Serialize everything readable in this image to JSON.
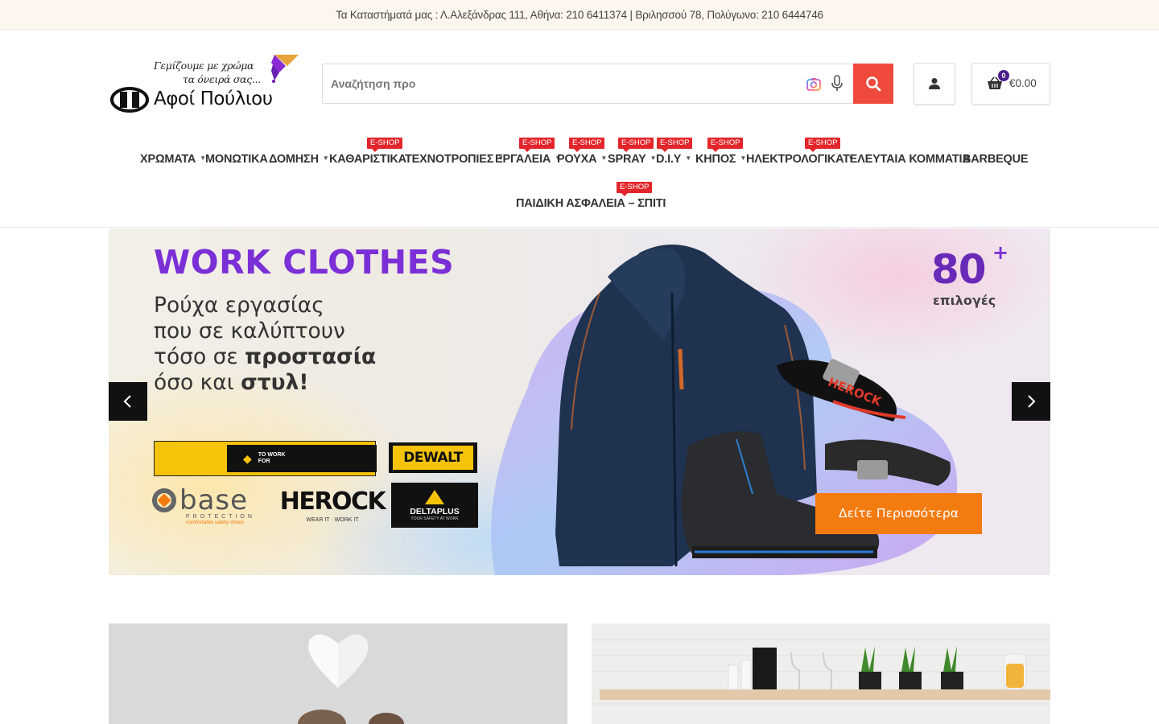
{
  "topbar": {
    "text": "Τα Καταστήματά μας : Λ.Αλεξάνδρας 111, Αθήνα: 210 6411374 | Βριλησσού 78, Πολύγωνο: 210 6444746"
  },
  "logo": {
    "tagline_line1": "Γεμίζουμε με χρώμα",
    "tagline_line2": "τα όνειρά σας...",
    "brand": "Αφοί Πούλιου"
  },
  "search": {
    "placeholder": "Αναζήτηση προ",
    "value": ""
  },
  "cart": {
    "count": "0",
    "total": "€0.00"
  },
  "nav": {
    "badge_label": "E-SHOP",
    "items": [
      {
        "label": "ΧΡΩΜΑΤΑ"
      },
      {
        "label": "ΜΟΝΩΤΙΚΑ"
      },
      {
        "label": "ΔΟΜΗΣΗ"
      },
      {
        "label": "ΚΑΘΑΡΙΣΤΙΚΑ"
      },
      {
        "label": "ΤΕΧΝΟΤΡΟΠΙΕΣ"
      },
      {
        "label": "ΕΡΓΑΛΕΙΑ"
      },
      {
        "label": "ΡΟΥΧΑ"
      },
      {
        "label": "SPRAY"
      },
      {
        "label": "D.I.Y"
      },
      {
        "label": "ΚΗΠΟΣ"
      },
      {
        "label": "ΗΛΕΚΤΡΟΛΟΓΙΚΑ"
      },
      {
        "label": "ΤΕΛΕΥΤΑΙΑ ΚΟΜΜΑΤΙΑ"
      },
      {
        "label": "BARBEQUE"
      },
      {
        "label": "ΠΑΙΔΙΚΗ ΑΣΦΑΛΕΙΑ – ΣΠΙΤΙ"
      }
    ]
  },
  "hero": {
    "title": "WORK CLOTHES",
    "line1": "Ρούχα εργασίας",
    "line2": "που σε καλύπτουν",
    "line3_pre": "τόσο σε ",
    "line3_bold": "προστασία",
    "line4_pre": "όσο και ",
    "line4_bold": "στυλ!",
    "count": "80",
    "count_plus": "+",
    "count_label": "επιλογές",
    "cta": "Δείτε Περισσότερα",
    "brands": {
      "toworkfor": "TO WORK FOR",
      "dewalt": "DEWALT",
      "base": "base",
      "base_sub": "PROTECTION",
      "base_tag": "comfortable safety shoes",
      "herock": "HEROCK",
      "herock_tag": "WEAR IT · WORK IT",
      "deltaplus": "DELTAPLUS",
      "deltaplus_tag": "YOUR SAFETY AT WORK",
      "belt_text": "HEROCK"
    }
  },
  "colors": {
    "accent_red": "#ef4a3c",
    "badge_red": "#e3262b",
    "hero_purple": "#7b2fd6",
    "cta_orange": "#f47b10",
    "cart_badge": "#4a1d8c"
  },
  "icons": {
    "search": "search-icon",
    "camera": "camera-icon",
    "microphone": "microphone-icon",
    "account": "user-icon",
    "cart": "basket-icon",
    "prev": "chevron-left-icon",
    "next": "chevron-right-icon"
  }
}
